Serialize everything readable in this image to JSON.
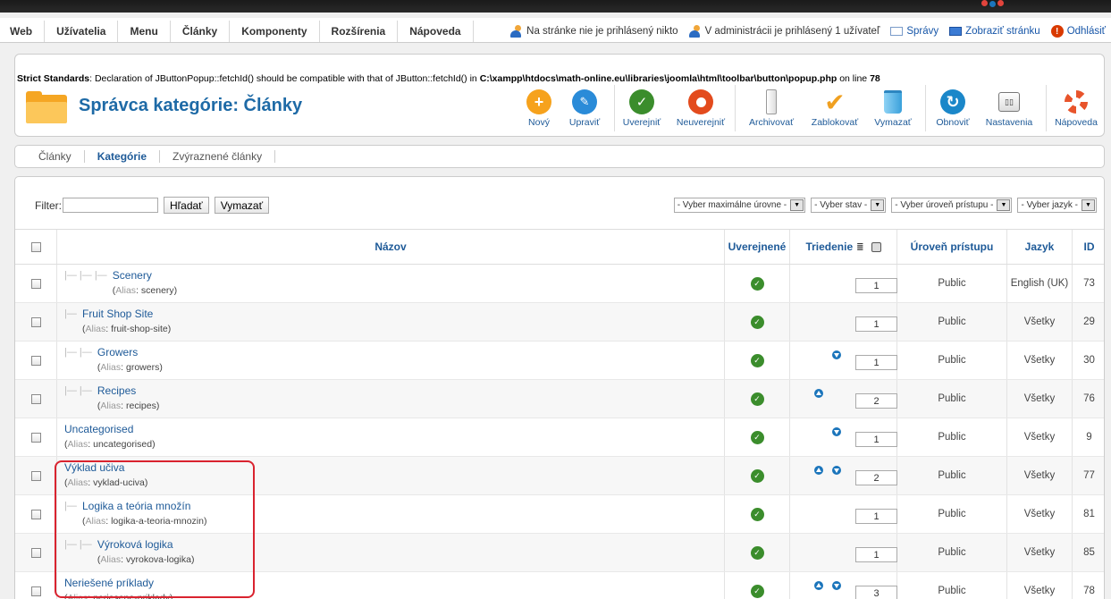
{
  "menu": [
    "Web",
    "Užívatelia",
    "Menu",
    "Články",
    "Komponenty",
    "Rozšírenia",
    "Nápoveda"
  ],
  "status": {
    "site_users": "Na stránke nie je prihlásený nikto",
    "admin_users": "V administrácii je prihlásený 1 užívateľ",
    "messages": "Správy",
    "view_site": "Zobraziť stránku",
    "logout": "Odhlásiť"
  },
  "warning": {
    "label": "Strict Standards",
    "text": ": Declaration of JButtonPopup::fetchId() should be compatible with that of JButton::fetchId() in ",
    "path": "C:\\xampp\\htdocs\\math-online.eu\\libraries\\joomla\\html\\toolbar\\button\\popup.php",
    "line_text": " on line ",
    "line": "78"
  },
  "title": "Správca kategórie: Články",
  "toolbar": {
    "new": "Nový",
    "edit": "Upraviť",
    "publish": "Uverejniť",
    "unpublish": "Neuverejniť",
    "archive": "Archivovať",
    "checkin": "Zablokovať",
    "trash": "Vymazať",
    "rebuild": "Obnoviť",
    "options": "Nastavenia",
    "help": "Nápoveda"
  },
  "tabs": [
    "Články",
    "Kategórie",
    "Zvýraznené články"
  ],
  "filter": {
    "label": "Filter:",
    "search_value": "",
    "search_button": "Hľadať",
    "clear_button": "Vymazať",
    "max_levels": "- Vyber maximálne úrovne -",
    "state": "- Vyber stav -",
    "access": "- Vyber úroveň prístupu -",
    "language": "- Vyber jazyk -"
  },
  "columns": {
    "title": "Názov",
    "published": "Uverejnené",
    "ordering": "Triedenie",
    "access": "Úroveň prístupu",
    "language": "Jazyk",
    "id": "ID"
  },
  "alias_label": "Alias",
  "rows": [
    {
      "tree": "|— |— |—  ",
      "name": "Scenery",
      "alias": "scenery",
      "order": "1",
      "up": false,
      "down": false,
      "access": "Public",
      "language": "English (UK)",
      "id": "73"
    },
    {
      "tree": "|—  ",
      "name": "Fruit Shop Site",
      "alias": "fruit-shop-site",
      "order": "1",
      "up": false,
      "down": false,
      "access": "Public",
      "language": "Všetky",
      "id": "29"
    },
    {
      "tree": "|— |—  ",
      "name": "Growers",
      "alias": "growers",
      "order": "1",
      "up": false,
      "down": true,
      "access": "Public",
      "language": "Všetky",
      "id": "30"
    },
    {
      "tree": "|— |—  ",
      "name": "Recipes",
      "alias": "recipes",
      "order": "2",
      "up": true,
      "down": false,
      "access": "Public",
      "language": "Všetky",
      "id": "76"
    },
    {
      "tree": "",
      "name": "Uncategorised",
      "alias": "uncategorised",
      "order": "1",
      "up": false,
      "down": true,
      "access": "Public",
      "language": "Všetky",
      "id": "9"
    },
    {
      "tree": "",
      "name": "Výklad učiva",
      "alias": "vyklad-uciva",
      "order": "2",
      "up": true,
      "down": true,
      "access": "Public",
      "language": "Všetky",
      "id": "77"
    },
    {
      "tree": "|—  ",
      "name": "Logika a teória množín",
      "alias": "logika-a-teoria-mnozin",
      "order": "1",
      "up": false,
      "down": false,
      "access": "Public",
      "language": "Všetky",
      "id": "81"
    },
    {
      "tree": "|— |—  ",
      "name": "Výroková logika",
      "alias": "vyrokova-logika",
      "order": "1",
      "up": false,
      "down": false,
      "access": "Public",
      "language": "Všetky",
      "id": "85"
    },
    {
      "tree": "",
      "name": "Neriešené príklady",
      "alias": "neriesene-priklady",
      "order": "3",
      "up": true,
      "down": true,
      "access": "Public",
      "language": "Všetky",
      "id": "78"
    }
  ],
  "colors": {
    "link": "#1e5a98",
    "published": "#3b8d2c",
    "highlight": "#d9232f"
  }
}
